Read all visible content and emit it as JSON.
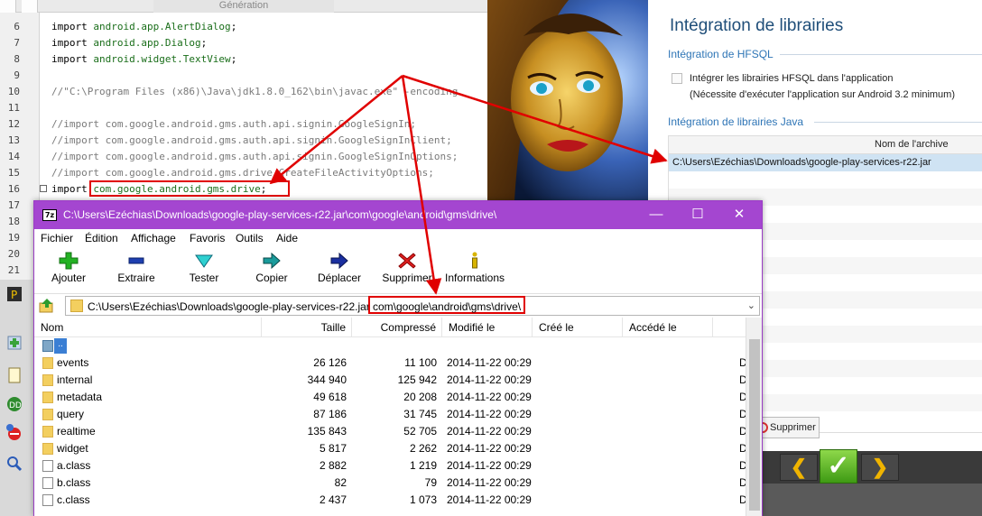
{
  "editor": {
    "tab_label": "Génération",
    "lines": [
      {
        "num": "6",
        "kw": "import ",
        "pkg": "android.app.AlertDialog",
        "rest": ";",
        "comment": ""
      },
      {
        "num": "7",
        "kw": "import ",
        "pkg": "android.app.Dialog",
        "rest": ";",
        "comment": ""
      },
      {
        "num": "8",
        "kw": "import ",
        "pkg": "android.widget.TextView",
        "rest": ";",
        "comment": ""
      },
      {
        "num": "9",
        "kw": "",
        "pkg": "",
        "rest": "",
        "comment": ""
      },
      {
        "num": "10",
        "kw": "",
        "pkg": "",
        "rest": "",
        "comment": "//\"C:\\Program Files (x86)\\Java\\jdk1.8.0_162\\bin\\javac.exe\" -encoding"
      },
      {
        "num": "11",
        "kw": "",
        "pkg": "",
        "rest": "",
        "comment": ""
      },
      {
        "num": "12",
        "kw": "",
        "pkg": "",
        "rest": "",
        "comment": "//import com.google.android.gms.auth.api.signin.GoogleSignIn;"
      },
      {
        "num": "13",
        "kw": "",
        "pkg": "",
        "rest": "",
        "comment": "//import com.google.android.gms.auth.api.signin.GoogleSignInClient;"
      },
      {
        "num": "14",
        "kw": "",
        "pkg": "",
        "rest": "",
        "comment": "//import com.google.android.gms.auth.api.signin.GoogleSignInOptions;"
      },
      {
        "num": "15",
        "kw": "",
        "pkg": "",
        "rest": "",
        "comment": "//import com.google.android.gms.drive.CreateFileActivityOptions;"
      },
      {
        "num": "16",
        "kw": "import ",
        "pkg": "com.google.android.gms.drive",
        "rest": ";",
        "comment": ""
      },
      {
        "num": "17",
        "kw": "",
        "pkg": "",
        "rest": "",
        "comment": ""
      },
      {
        "num": "18",
        "kw": "",
        "pkg": "",
        "rest": "",
        "comment": ""
      },
      {
        "num": "19",
        "kw": "",
        "pkg": "",
        "rest": "",
        "comment": ""
      },
      {
        "num": "20",
        "kw": "",
        "pkg": "",
        "rest": "",
        "comment": ""
      },
      {
        "num": "21",
        "kw": "",
        "pkg": "",
        "rest": "",
        "comment": ""
      }
    ]
  },
  "wizard": {
    "title": "Intégration de librairies",
    "hfsql_section": "Intégration de HFSQL",
    "hfsql_checkbox_label": "Intégrer les librairies HFSQL dans l'application",
    "hfsql_note": "(Nécessite d'exécuter l'application sur Android 3.2 minimum)",
    "java_section": "Intégration de librairies Java",
    "archive_column": "Nom de l'archive",
    "archive_row": "C:\\Users\\Ezéchias\\Downloads\\google-play-services-r22.jar",
    "delete_label": "Supprimer",
    "nav_prev": "❮",
    "nav_ok": "✓",
    "nav_next": "❯"
  },
  "zip": {
    "title": "C:\\Users\\Ezéchias\\Downloads\\google-play-services-r22.jar\\com\\google\\android\\gms\\drive\\",
    "app_icon": "7z",
    "win_min": "—",
    "win_max": "☐",
    "win_close": "✕",
    "menu": [
      "Fichier",
      "Édition",
      "Affichage",
      "Favoris",
      "Outils",
      "Aide"
    ],
    "tools": [
      {
        "label": "Ajouter",
        "icon": "plus-icon"
      },
      {
        "label": "Extraire",
        "icon": "minus-icon"
      },
      {
        "label": "Tester",
        "icon": "check-triangle-icon"
      },
      {
        "label": "Copier",
        "icon": "copy-arrow-icon"
      },
      {
        "label": "Déplacer",
        "icon": "move-arrow-icon"
      },
      {
        "label": "Supprimer",
        "icon": "delete-x-icon"
      },
      {
        "label": "Informations",
        "icon": "info-icon"
      }
    ],
    "address_base": "C:\\Users\\Ezéchias\\Downloads\\google-play-services-r22.jar",
    "address_sub": "com\\google\\android\\gms\\drive\\",
    "address_dropdown": "⌄",
    "columns": {
      "name": "Nom",
      "size": "Taille",
      "packed": "Compressé",
      "modified": "Modifié le",
      "created": "Créé le",
      "accessed": "Accédé le"
    },
    "updir_label": "..",
    "files": [
      {
        "name": "events",
        "type": "folder",
        "size": "26 126",
        "packed": "11 100",
        "modified": "2014-11-22 00:29"
      },
      {
        "name": "internal",
        "type": "folder",
        "size": "344 940",
        "packed": "125 942",
        "modified": "2014-11-22 00:29"
      },
      {
        "name": "metadata",
        "type": "folder",
        "size": "49 618",
        "packed": "20 208",
        "modified": "2014-11-22 00:29"
      },
      {
        "name": "query",
        "type": "folder",
        "size": "87 186",
        "packed": "31 745",
        "modified": "2014-11-22 00:29"
      },
      {
        "name": "realtime",
        "type": "folder",
        "size": "135 843",
        "packed": "52 705",
        "modified": "2014-11-22 00:29"
      },
      {
        "name": "widget",
        "type": "folder",
        "size": "5 817",
        "packed": "2 262",
        "modified": "2014-11-22 00:29"
      },
      {
        "name": "a.class",
        "type": "file",
        "size": "2 882",
        "packed": "1 219",
        "modified": "2014-11-22 00:29"
      },
      {
        "name": "b.class",
        "type": "file",
        "size": "82",
        "packed": "79",
        "modified": "2014-11-22 00:29"
      },
      {
        "name": "c.class",
        "type": "file",
        "size": "2 437",
        "packed": "1 073",
        "modified": "2014-11-22 00:29"
      }
    ],
    "trailing_col_letter": "D"
  },
  "colors": {
    "zip_titlebar": "#a446d0",
    "annotation_red": "#e00000",
    "wizard_title": "#1f4e79",
    "wizard_section": "#2e75b6"
  }
}
